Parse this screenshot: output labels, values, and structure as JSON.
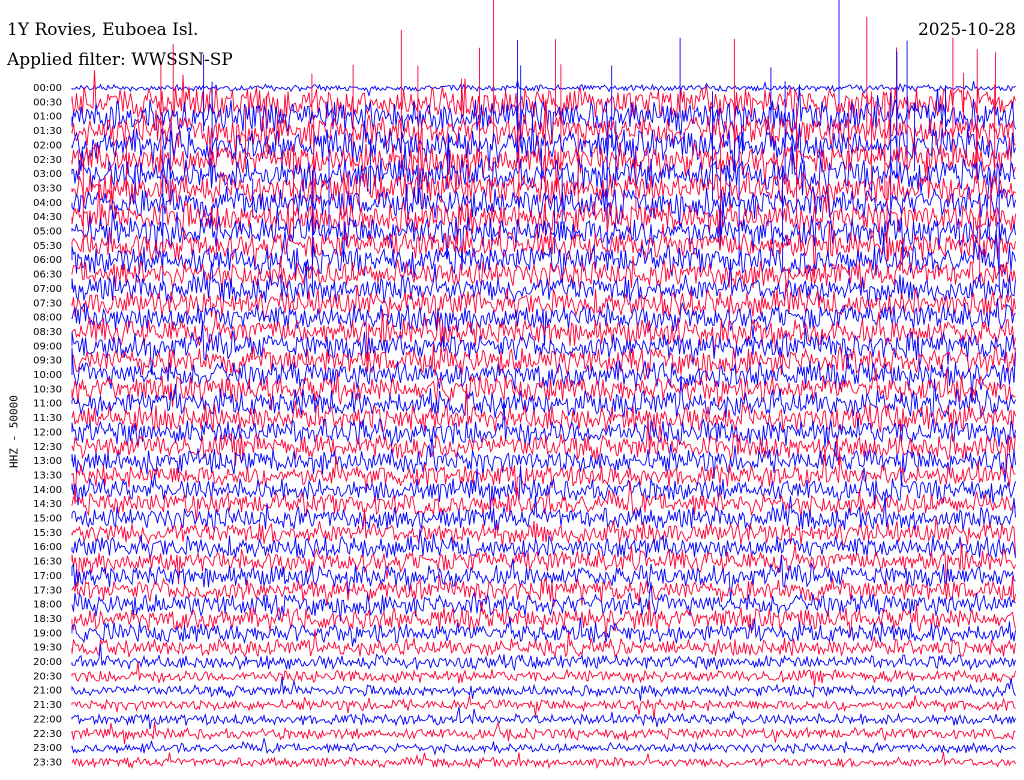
{
  "header": {
    "title": "1Y Rovies, Euboea Isl.",
    "date": "2025-10-28",
    "filter": "Applied filter: WWSSN-SP"
  },
  "chart_data": {
    "type": "line",
    "title": "1Y Rovies, Euboea Isl.",
    "subtitle": "Applied filter: WWSSN-SP",
    "ylabel": "HHZ - 50000",
    "row_labels": [
      "00:00",
      "00:30",
      "01:00",
      "01:30",
      "02:00",
      "02:30",
      "03:00",
      "03:30",
      "04:00",
      "04:30",
      "05:00",
      "05:30",
      "06:00",
      "06:30",
      "07:00",
      "07:30",
      "08:00",
      "08:30",
      "09:00",
      "09:30",
      "10:00",
      "10:30",
      "11:00",
      "11:30",
      "12:00",
      "12:30",
      "13:00",
      "13:30",
      "14:00",
      "14:30",
      "15:00",
      "15:30",
      "16:00",
      "16:30",
      "17:00",
      "17:30",
      "18:00",
      "18:30",
      "19:00",
      "19:30",
      "20:00",
      "20:30",
      "21:00",
      "21:30",
      "22:00",
      "22:30",
      "23:00",
      "23:30"
    ],
    "series_colors": [
      "#0000ff",
      "#ff0033"
    ],
    "row_amplitude": [
      0.2,
      1.0,
      1.0,
      1.0,
      1.0,
      1.0,
      1.0,
      1.0,
      0.95,
      0.95,
      0.95,
      0.9,
      0.9,
      0.85,
      0.85,
      0.85,
      0.85,
      0.85,
      0.85,
      0.85,
      0.85,
      0.85,
      0.85,
      0.85,
      0.85,
      0.8,
      0.75,
      0.7,
      0.7,
      0.7,
      0.7,
      0.7,
      0.7,
      0.7,
      0.7,
      0.7,
      0.7,
      0.7,
      0.65,
      0.55,
      0.45,
      0.4,
      0.35,
      0.35,
      0.35,
      0.35,
      0.3,
      0.3
    ],
    "grid": false
  }
}
